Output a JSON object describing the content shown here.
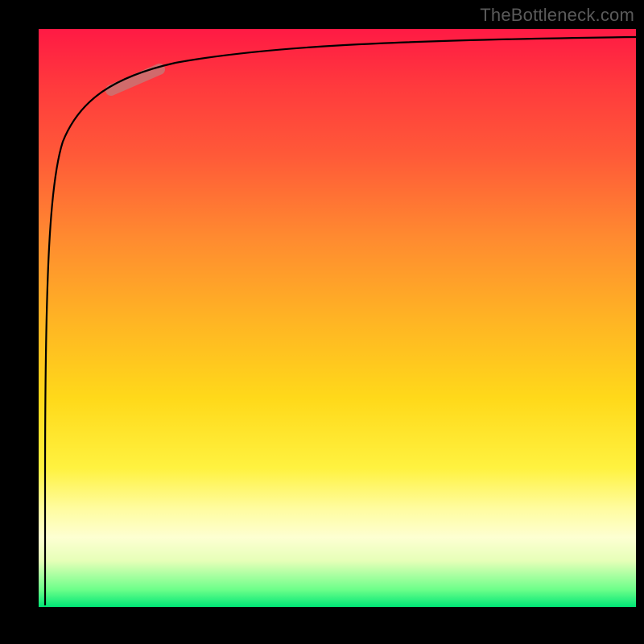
{
  "watermark": "TheBottleneck.com",
  "colors": {
    "frame": "#000000",
    "curve": "#000000",
    "highlight": "#c47a78",
    "gradient_stops": [
      "#ff1a44",
      "#ff5a38",
      "#ffb324",
      "#fff240",
      "#fdffd2",
      "#00e676"
    ]
  },
  "chart_data": {
    "type": "line",
    "title": "",
    "xlabel": "",
    "ylabel": "",
    "xlim": [
      0,
      100
    ],
    "ylim": [
      0,
      100
    ],
    "grid": false,
    "series": [
      {
        "name": "bottleneck-curve",
        "x": [
          0.5,
          1,
          1.5,
          2,
          3,
          4,
          6,
          8,
          12,
          18,
          25,
          35,
          50,
          70,
          100
        ],
        "y": [
          2,
          20,
          45,
          60,
          74,
          80,
          85,
          88,
          91,
          93,
          94.5,
          95.5,
          96.3,
          97,
          97.5
        ]
      }
    ],
    "annotations": [
      {
        "name": "highlight-segment",
        "x_range": [
          10,
          18
        ],
        "y_range": [
          89,
          93
        ]
      }
    ]
  }
}
